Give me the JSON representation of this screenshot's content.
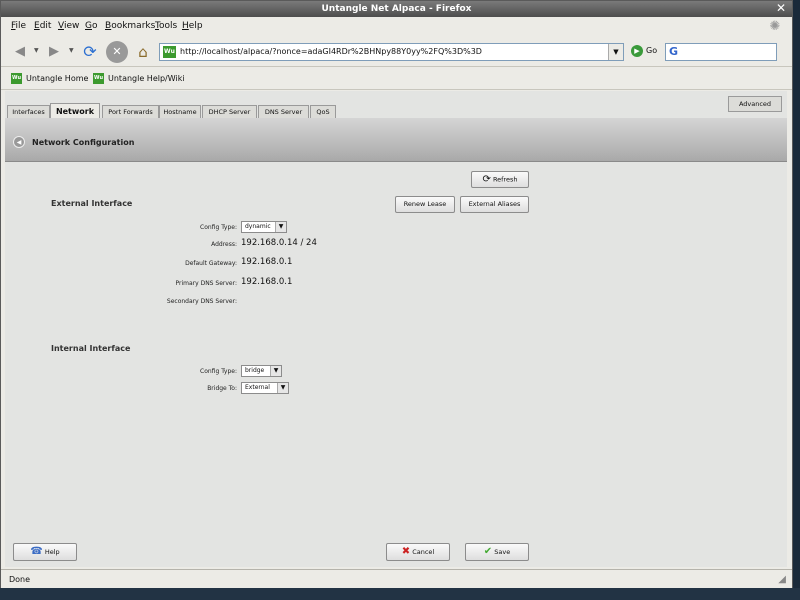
{
  "window": {
    "title": "Untangle Net Alpaca - Firefox"
  },
  "menu": [
    "File",
    "Edit",
    "View",
    "Go",
    "Bookmarks",
    "Tools",
    "Help"
  ],
  "nav": {
    "url": "http://localhost/alpaca/?nonce=adaGI4RDr%2BHNpy88Y0yy%2FQ%3D%3D",
    "go_label": "Go",
    "search_placeholder": ""
  },
  "bookmarks": [
    "Untangle Home",
    "Untangle Help/Wiki"
  ],
  "tabs": [
    "Interfaces",
    "Network",
    "Port Forwards",
    "Hostname",
    "DHCP Server",
    "DNS Server",
    "QoS"
  ],
  "advanced_label": "Advanced",
  "header_title": "Network Configuration",
  "refresh_label": "Refresh",
  "external": {
    "title": "External Interface",
    "renew_label": "Renew Lease",
    "aliases_label": "External Aliases",
    "config_type_label": "Config Type:",
    "config_type_value": "dynamic",
    "address_label": "Address:",
    "address_value": "192.168.0.14 / 24",
    "gateway_label": "Default Gateway:",
    "gateway_value": "192.168.0.1",
    "primary_dns_label": "Primary DNS Server:",
    "primary_dns_value": "192.168.0.1",
    "secondary_dns_label": "Secondary DNS Server:",
    "secondary_dns_value": ""
  },
  "internal": {
    "title": "Internal Interface",
    "config_type_label": "Config Type:",
    "config_type_value": "bridge",
    "bridge_to_label": "Bridge To:",
    "bridge_to_value": "External"
  },
  "bottom": {
    "help_label": "Help",
    "cancel_label": "Cancel",
    "save_label": "Save"
  },
  "status": "Done",
  "colors": {
    "accent_green": "#3c9a2e",
    "cancel_red": "#cc2222",
    "save_green": "#44aa33"
  }
}
